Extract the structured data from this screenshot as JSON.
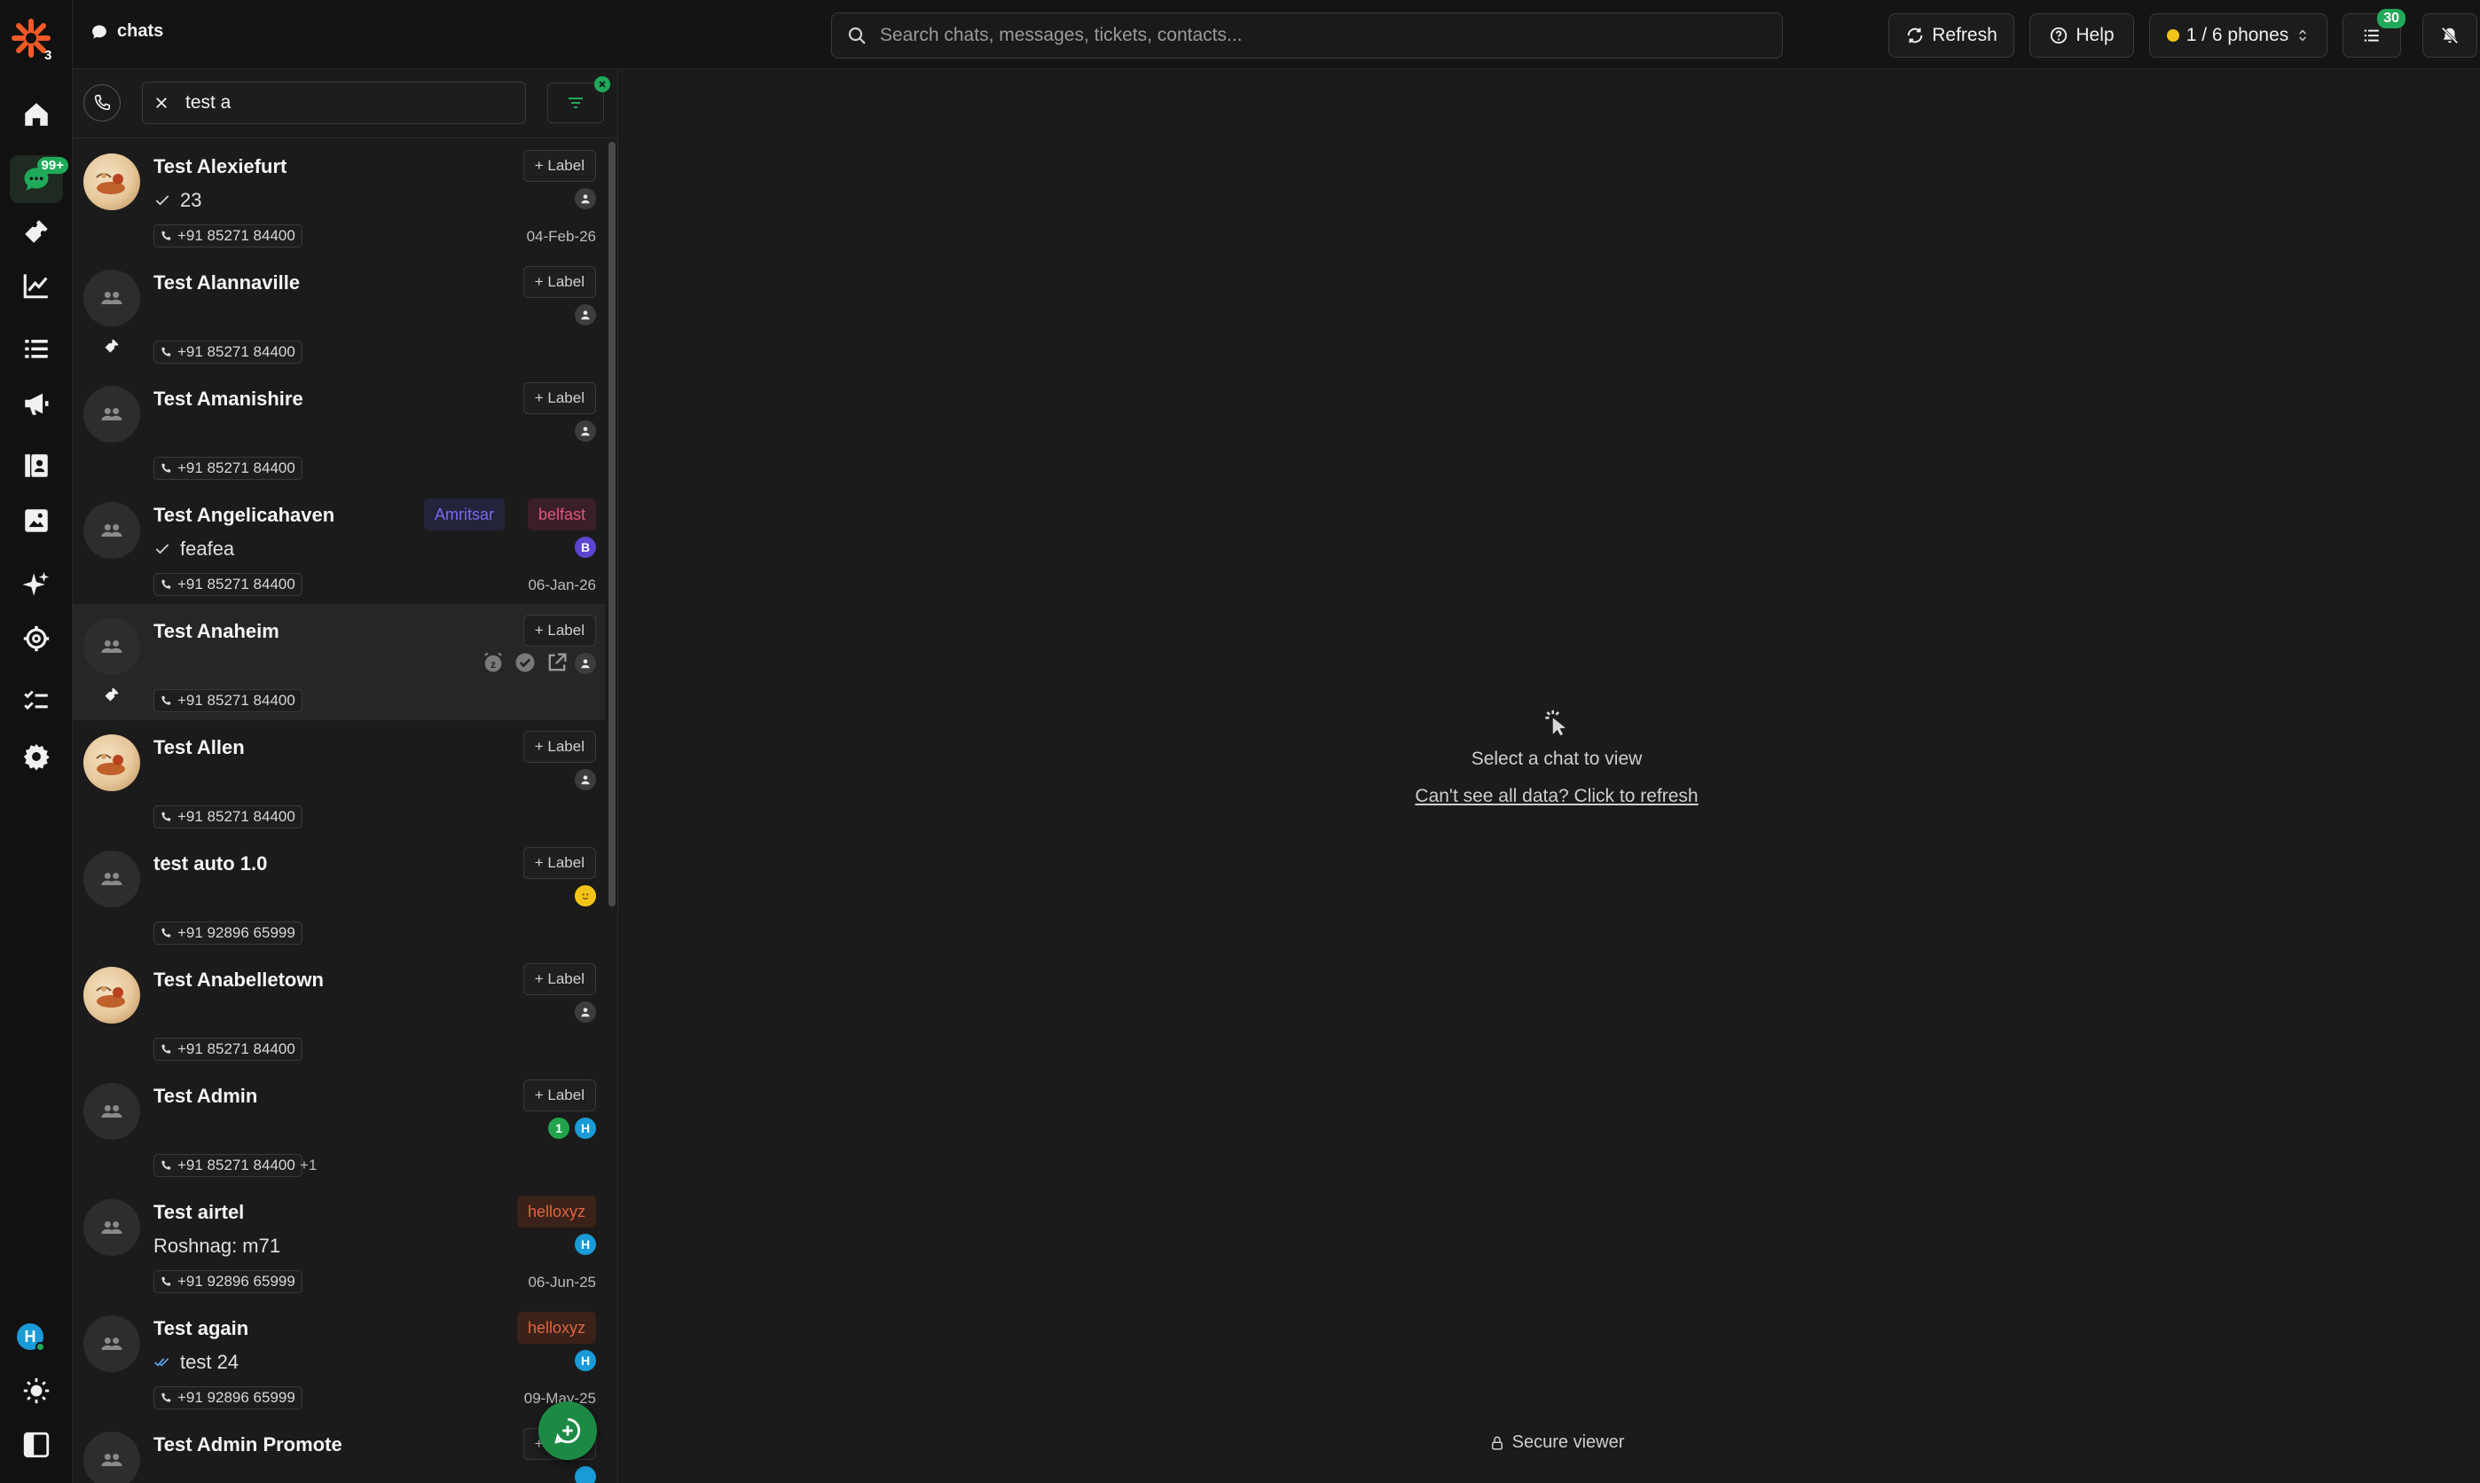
{
  "app": {
    "logo_badge": "3"
  },
  "rail": {
    "chats_badge": "99+"
  },
  "header": {
    "title": "chats",
    "search_placeholder": "Search chats, messages, tickets, contacts...",
    "refresh_label": "Refresh",
    "help_label": "Help",
    "phones_label": "1 / 6 phones",
    "tasks_badge": "30"
  },
  "list": {
    "filter_value": "test a",
    "label_button": "+ Label",
    "chats": [
      {
        "name": "Test Alexiefurt",
        "preview": "23",
        "phone": "+91 85271 84400",
        "date": "04-Feb-26"
      },
      {
        "name": "Test Alannaville",
        "phone": "+91 85271 84400"
      },
      {
        "name": "Test Amanishire",
        "phone": "+91 85271 84400"
      },
      {
        "name": "Test Angelicahaven",
        "preview": "feafea",
        "phone": "+91 85271 84400",
        "date": "06-Jan-26",
        "tags": [
          "Amritsar",
          "belfast"
        ],
        "assignee": "B"
      },
      {
        "name": "Test Anaheim",
        "phone": "+91 85271 84400"
      },
      {
        "name": "Test Allen",
        "phone": "+91 85271 84400"
      },
      {
        "name": "test auto 1.0",
        "phone": "+91 92896 65999"
      },
      {
        "name": "Test Anabelletown",
        "phone": "+91 85271 84400"
      },
      {
        "name": "Test Admin",
        "phone": "+91 85271 84400",
        "extra": "+1",
        "assignees": [
          "1",
          "H"
        ]
      },
      {
        "name": "Test airtel",
        "preview": "Roshnag: m71",
        "phone": "+91 92896 65999",
        "date": "06-Jun-25",
        "tags": [
          "helloxyz"
        ],
        "assignee": "H"
      },
      {
        "name": "Test again",
        "preview": "test 24",
        "phone": "+91 92896 65999",
        "date": "09-May-25",
        "tags": [
          "helloxyz"
        ],
        "assignee": "H"
      },
      {
        "name": "Test Admin Promote"
      }
    ]
  },
  "viewer": {
    "empty_text": "Select a chat to view",
    "refresh_link": "Can't see all data? Click to refresh",
    "secure_text": "Secure viewer"
  },
  "colors": {
    "accent_green": "#1faa59",
    "brand_orange": "#f05a28",
    "warning_yellow": "#f2c417"
  }
}
